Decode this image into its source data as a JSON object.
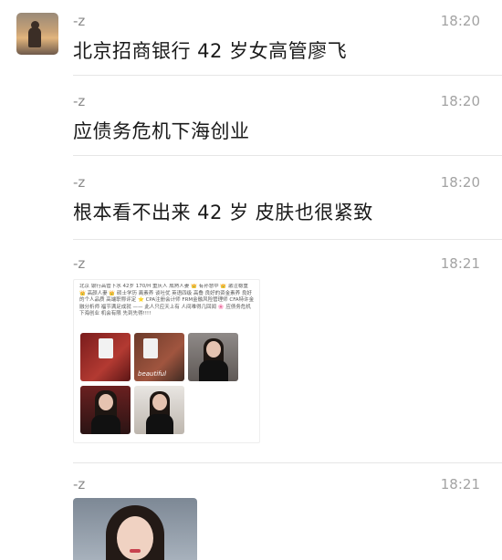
{
  "messages": [
    {
      "sender": "-z",
      "time": "18:20",
      "text": "北京招商银行 42 岁女高管廖飞"
    },
    {
      "sender": "-z",
      "time": "18:20",
      "text": "应债务危机下海创业"
    },
    {
      "sender": "-z",
      "time": "18:20",
      "text": "根本看不出来 42 岁 皮肤也很紧致"
    },
    {
      "sender": "-z",
      "time": "18:21",
      "card_text": "北京 银行高管下水 42岁 170/H 重庆人 成熟人妻 👑 有孙慧中 👑 激注稳重 👑 高颜人妻 👑 硕士学历 离素养 谈吐优 英语四级 高叠 良好的资金素养 良好的个人品质 高端职称评定 ⭐ CPA注册会计师 FRM金融风险管理师 CFA特许金融分析师 福节满足成就 —— 此人只应天上有 人间难得几回闻 🌸 应债务危机 下海创业 机会有限 先到先得!!!!",
      "card_watermark": "beautiful"
    },
    {
      "sender": "-z",
      "time": "18:21"
    }
  ]
}
